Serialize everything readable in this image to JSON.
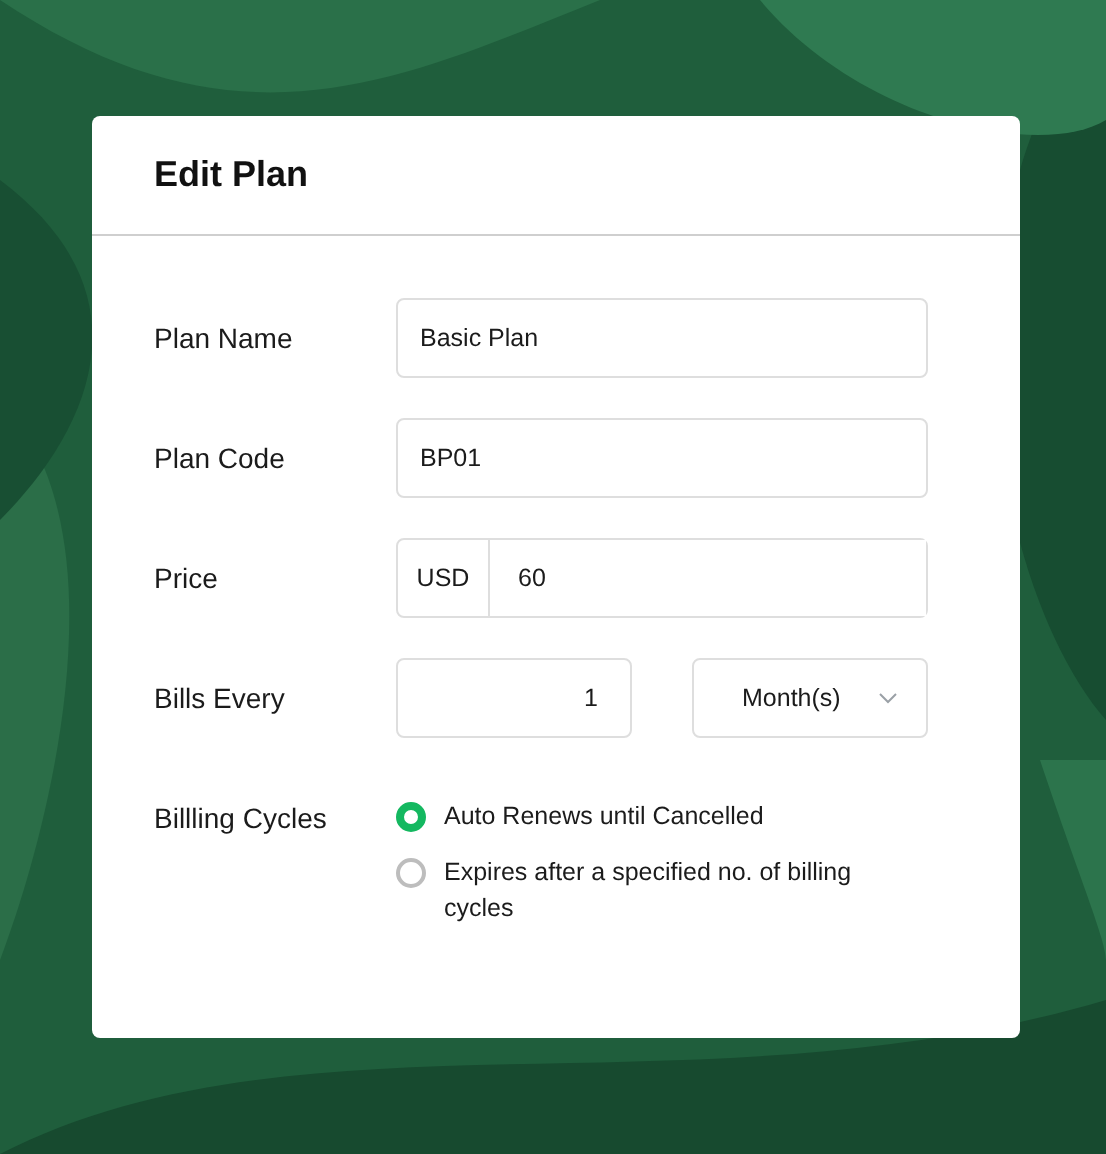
{
  "dialog": {
    "title": "Edit Plan",
    "fields": [
      {
        "kind": "text",
        "label": "Plan Name",
        "value": "Basic Plan"
      },
      {
        "kind": "text",
        "label": "Plan Code",
        "value": "BP01"
      },
      {
        "kind": "currency",
        "label": "Price",
        "currency": "USD",
        "value": "60"
      },
      {
        "kind": "interval",
        "label": "Bills Every",
        "value": "1",
        "unit": "Month(s)"
      },
      {
        "kind": "radio",
        "label": "Billling Cycles",
        "options": [
          {
            "label": "Auto Renews until Cancelled",
            "selected": true
          },
          {
            "label": "Expires after a specified no. of billing cycles",
            "selected": false
          }
        ]
      }
    ]
  }
}
